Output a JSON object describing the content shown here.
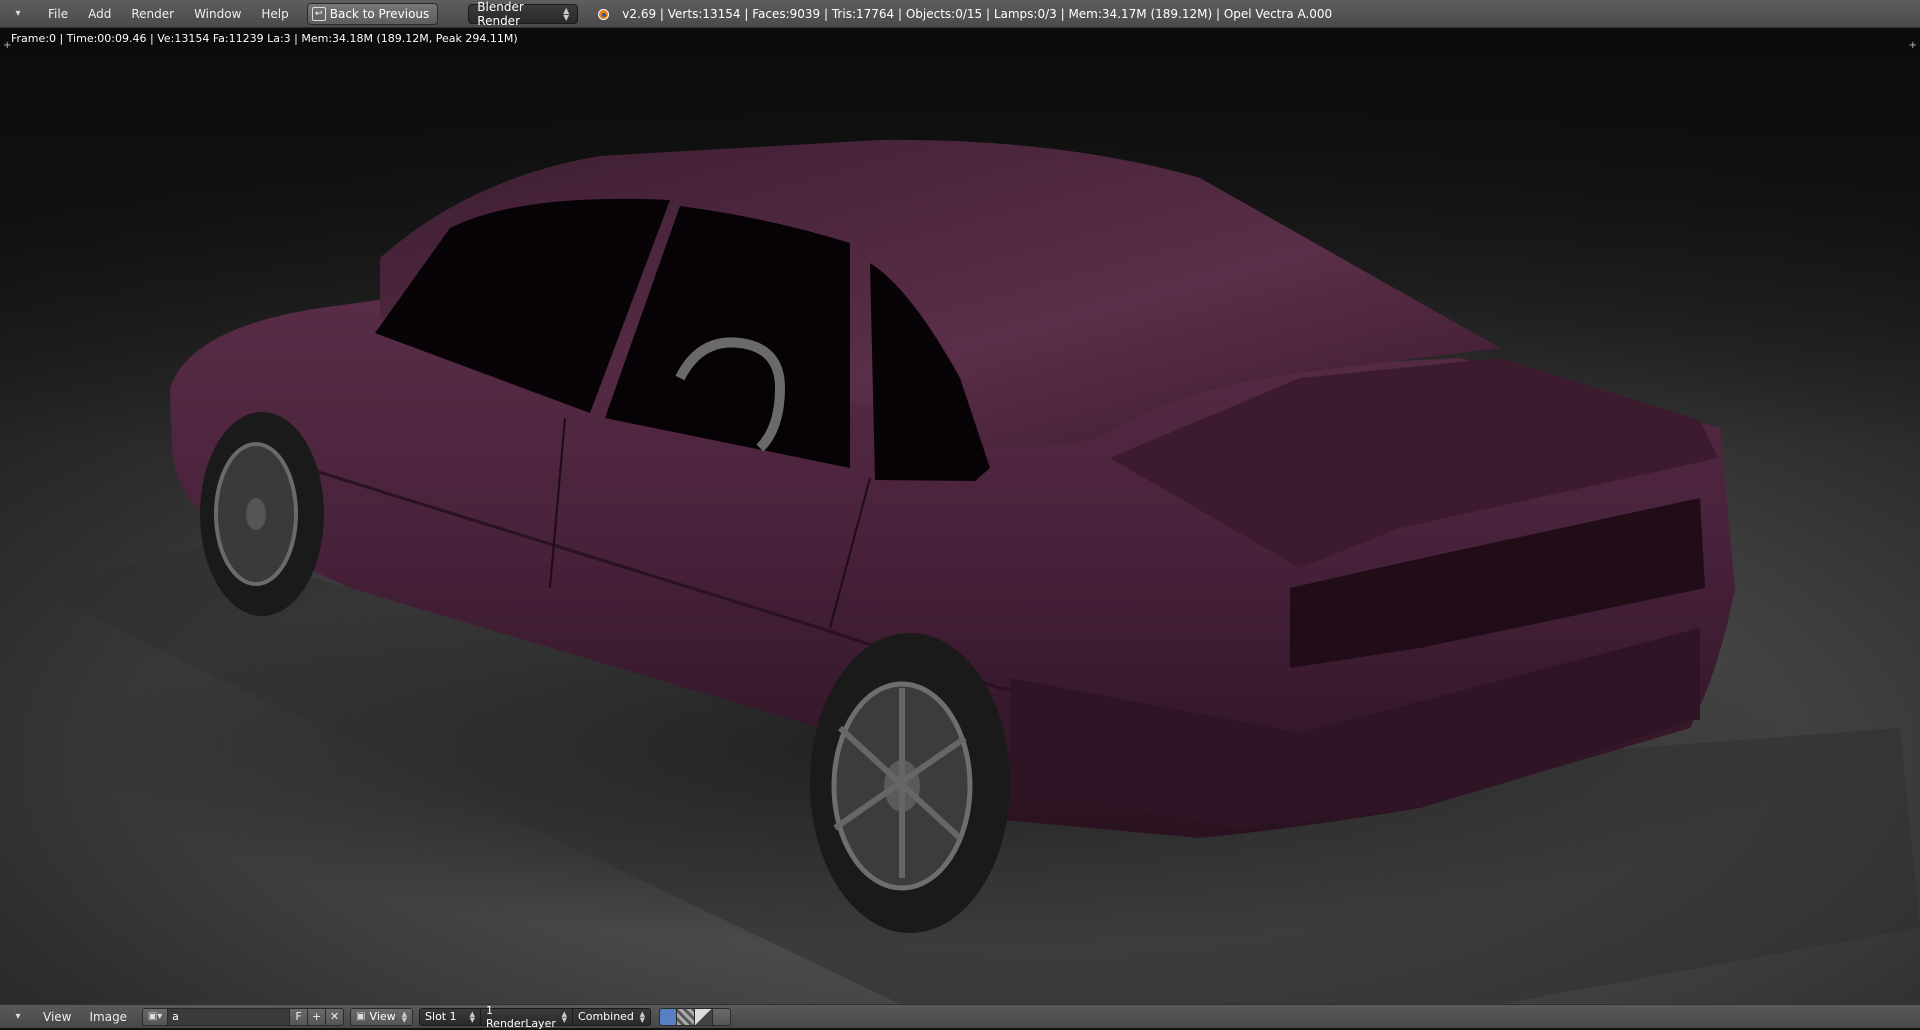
{
  "header": {
    "menu": [
      "File",
      "Add",
      "Render",
      "Window",
      "Help"
    ],
    "back_button": "Back to Previous",
    "render_engine": "Blender Render",
    "stats": "v2.69 | Verts:13154 | Faces:9039 | Tris:17764 | Objects:0/15 | Lamps:0/3 | Mem:34.17M (189.12M) | Opel Vectra A.000"
  },
  "viewport": {
    "render_info": "Frame:0 | Time:00:09.46 | Ve:13154 Fa:11239 La:3 | Mem:34.18M (189.12M, Peak 294.11M)",
    "car_color": "#4a2338"
  },
  "footer": {
    "view_menu": "View",
    "image_menu": "Image",
    "image_name": "a",
    "fake_user_label": "F",
    "new_image_label": "+",
    "unlink_label": "✕",
    "view_select": "View",
    "slot_select": "Slot 1",
    "render_layer_select": "1 RenderLayer",
    "pass_select": "Combined"
  },
  "icons": [
    "editor-type-icon",
    "blender-logo-icon",
    "image-browse-icon",
    "view-image-icon",
    "color-alpha-icon",
    "alpha-icon",
    "z-buffer-icon",
    "stop-icon"
  ]
}
